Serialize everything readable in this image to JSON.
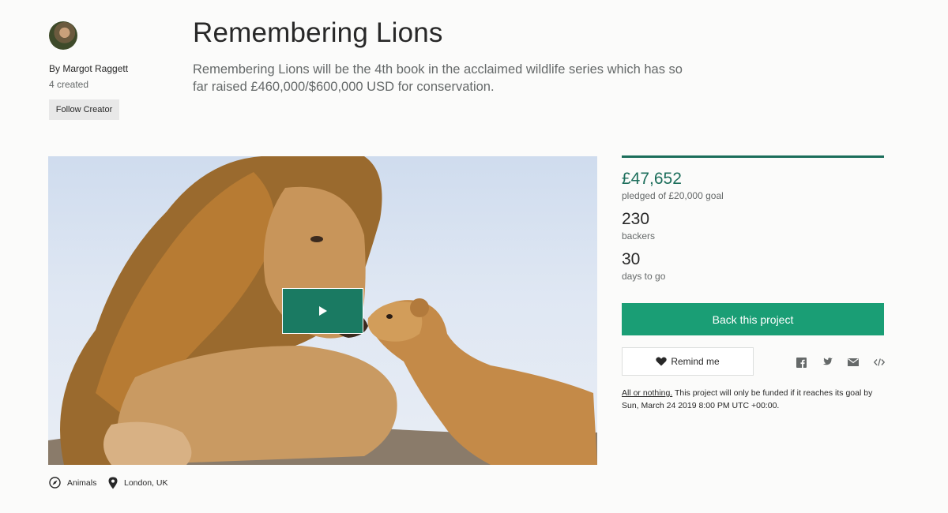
{
  "creator": {
    "by_line": "By Margot Raggett",
    "created_count": "4 created",
    "follow_label": "Follow Creator"
  },
  "project": {
    "title": "Remembering Lions",
    "blurb": "Remembering Lions will be the 4th book in the acclaimed wildlife series which has so far raised £460,000/$600,000 USD for conservation."
  },
  "stats": {
    "pledged": "£47,652",
    "pledged_sub": "pledged of £20,000 goal",
    "backers": "230",
    "backers_sub": "backers",
    "days": "30",
    "days_sub": "days to go",
    "funded_fraction": 1.0
  },
  "actions": {
    "back_label": "Back this project",
    "remind_label": "Remind me"
  },
  "share_icons": [
    "facebook-icon",
    "twitter-icon",
    "email-icon",
    "embed-icon"
  ],
  "notice": {
    "link": "All or nothing.",
    "text": " This project will only be funded if it reaches its goal by Sun, March 24 2019 8:00 PM UTC +00:00."
  },
  "meta": {
    "category": "Animals",
    "location": "London, UK"
  },
  "colors": {
    "accent": "#1c6e5b",
    "button": "#1a9e75",
    "play": "#1a7a62"
  }
}
